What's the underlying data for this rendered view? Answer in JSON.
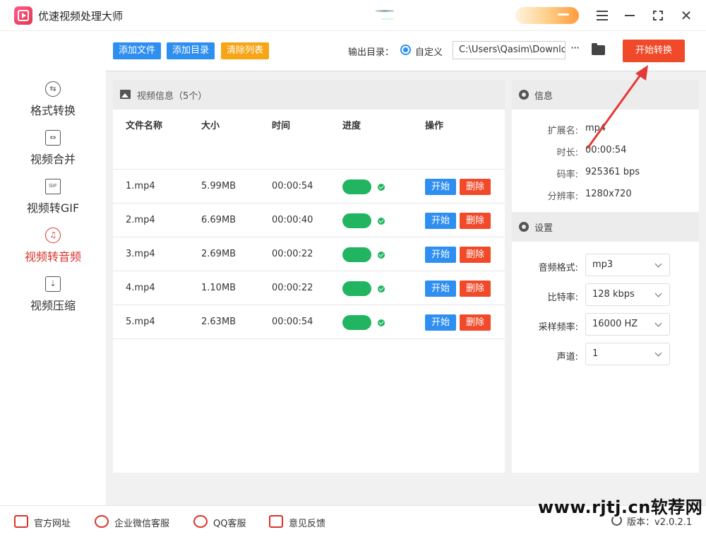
{
  "app": {
    "title": "优速视频处理大师"
  },
  "sidebar": {
    "items": [
      {
        "label": "格式转换",
        "icon": "format-convert-icon",
        "active": false
      },
      {
        "label": "视频合并",
        "icon": "merge-icon",
        "active": false
      },
      {
        "label": "视频转GIF",
        "icon": "gif-icon",
        "active": false
      },
      {
        "label": "视频转音频",
        "icon": "audio-icon",
        "active": true
      },
      {
        "label": "视频压缩",
        "icon": "compress-icon",
        "active": false
      }
    ]
  },
  "toolbar": {
    "add_file": "添加文件",
    "add_dir": "添加目录",
    "clear_list": "清除列表",
    "output_label": "输出目录：",
    "custom_label": "自定义",
    "output_path": "C:\\Users\\Qasim\\Downlo",
    "more": "···",
    "start_convert": "开始转换"
  },
  "video_list": {
    "title": "视频信息（5个）",
    "columns": [
      "文件名称",
      "大小",
      "时间",
      "进度",
      "操作"
    ],
    "start_label": "开始",
    "delete_label": "删除",
    "rows": [
      {
        "name": "1.mp4",
        "size": "5.99MB",
        "time": "00:00:54"
      },
      {
        "name": "2.mp4",
        "size": "6.69MB",
        "time": "00:00:40"
      },
      {
        "name": "3.mp4",
        "size": "2.69MB",
        "time": "00:00:22"
      },
      {
        "name": "4.mp4",
        "size": "1.10MB",
        "time": "00:00:22"
      },
      {
        "name": "5.mp4",
        "size": "2.63MB",
        "time": "00:00:54"
      }
    ]
  },
  "info": {
    "title": "信息",
    "fields": [
      {
        "label": "扩展名:",
        "value": "mp4"
      },
      {
        "label": "时长:",
        "value": "00:00:54"
      },
      {
        "label": "码率:",
        "value": "925361 bps"
      },
      {
        "label": "分辨率:",
        "value": "1280x720"
      }
    ]
  },
  "settings": {
    "title": "设置",
    "fields": [
      {
        "label": "音频格式:",
        "value": "mp3"
      },
      {
        "label": "比特率:",
        "value": "128 kbps"
      },
      {
        "label": "采样频率:",
        "value": "16000 HZ"
      },
      {
        "label": "声道:",
        "value": "1"
      }
    ]
  },
  "footer": {
    "website": "官方网址",
    "wechat": "企业微信客服",
    "qq": "QQ客服",
    "feedback": "意见反馈",
    "version": "版本：v2.0.2.1"
  },
  "watermark": "www.rjtj.cn软荐网",
  "colors": {
    "accent_blue": "#2f8ff0",
    "accent_red": "#f04a2a",
    "accent_orange": "#f5a516",
    "progress_green": "#22b561",
    "active_red": "#d9342b"
  }
}
